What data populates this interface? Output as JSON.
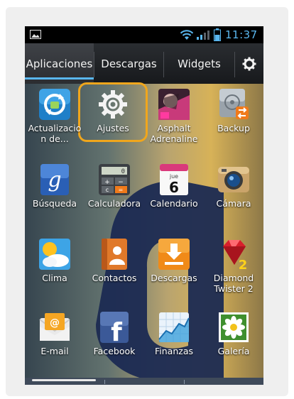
{
  "status_bar": {
    "time": "11:37",
    "icons": [
      "gallery-icon",
      "wifi-icon",
      "signal-icon",
      "battery-icon"
    ],
    "accent_color": "#5ab7ef"
  },
  "tabs": [
    {
      "label": "Aplicaciones",
      "active": true
    },
    {
      "label": "Descargas",
      "active": false
    },
    {
      "label": "Widgets",
      "active": false
    }
  ],
  "settings_icon": "gear-icon",
  "highlight_color": "#f0a61c",
  "apps": [
    {
      "label": "Actualización de...",
      "label_line1": "Actualizacio",
      "label_line2": "n de...",
      "icon": "software-update-icon"
    },
    {
      "label": "Ajustes",
      "icon": "settings-gear-icon",
      "highlighted": true
    },
    {
      "label": "Asphalt Adrenaline",
      "label_line1": "Asphalt",
      "label_line2": "Adrenaline",
      "icon": "asphalt-game-icon"
    },
    {
      "label": "Backup",
      "icon": "backup-icon"
    },
    {
      "label": "Búsqueda",
      "icon": "google-search-icon"
    },
    {
      "label": "Calculadora",
      "icon": "calculator-icon"
    },
    {
      "label": "Calendario",
      "icon": "calendar-icon",
      "calendar_day": "jue",
      "calendar_date": "6"
    },
    {
      "label": "Cámara",
      "icon": "camera-icon"
    },
    {
      "label": "Clima",
      "icon": "weather-icon"
    },
    {
      "label": "Contactos",
      "icon": "contacts-icon"
    },
    {
      "label": "Descargas",
      "icon": "downloads-icon"
    },
    {
      "label": "Diamond Twister 2",
      "label_line1": "Diamond",
      "label_line2": "Twister 2",
      "icon": "diamond-twister-icon"
    },
    {
      "label": "E-mail",
      "icon": "email-icon"
    },
    {
      "label": "Facebook",
      "icon": "facebook-icon"
    },
    {
      "label": "Finanzas",
      "icon": "finance-chart-icon"
    },
    {
      "label": "Galería",
      "icon": "gallery-flower-icon"
    }
  ]
}
